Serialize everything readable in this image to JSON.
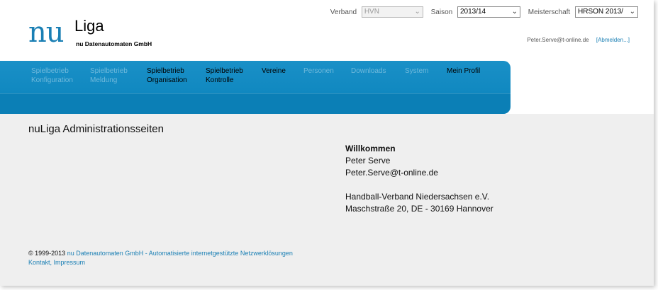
{
  "header": {
    "logo_nu": "nu",
    "logo_liga": "Liga",
    "logo_company": "nu Datenautomaten GmbH",
    "verband_label": "Verband",
    "verband_value": "HVN",
    "saison_label": "Saison",
    "saison_value": "2013/14",
    "meisterschaft_label": "Meisterschaft",
    "meisterschaft_value": "HRSON 2013/",
    "user_email": "Peter.Serve@t-online.de",
    "logout_label": "[Abmelden...]"
  },
  "nav": {
    "items": [
      {
        "line1": "Spielbetrieb",
        "line2": "Konfiguration",
        "active": false
      },
      {
        "line1": "Spielbetrieb",
        "line2": "Meldung",
        "active": false
      },
      {
        "line1": "Spielbetrieb",
        "line2": "Organisation",
        "active": true
      },
      {
        "line1": "Spielbetrieb",
        "line2": "Kontrolle",
        "active": true
      },
      {
        "line1": "Vereine",
        "line2": "",
        "active": true
      },
      {
        "line1": "Personen",
        "line2": "",
        "active": false
      },
      {
        "line1": "Downloads",
        "line2": "",
        "active": false
      },
      {
        "line1": "System",
        "line2": "",
        "active": false
      },
      {
        "line1": "Mein Profil",
        "line2": "",
        "active": true
      }
    ]
  },
  "main": {
    "title": "nuLiga Administrationsseiten",
    "welcome": {
      "heading": "Willkommen",
      "name": "Peter Serve",
      "email": "Peter.Serve@t-online.de",
      "org": "Handball-Verband Niedersachsen e.V.",
      "address": "Maschstraße 20, DE - 30169 Hannover"
    }
  },
  "footer": {
    "copyright": "© 1999-2013",
    "company_link": "nu Datenautomaten GmbH - Automatisierte internetgestützte Netzwerklösungen",
    "contact_links": "Kontakt, Impressum"
  },
  "colors": {
    "accent": "#1a7fb4",
    "nav_bg": "#1088c0",
    "content_bg": "#efefef"
  },
  "icons": {
    "dropdown": "chevron-down-icon"
  }
}
